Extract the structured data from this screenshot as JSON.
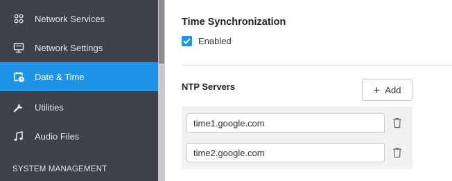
{
  "sidebar": {
    "items": [
      {
        "label": "Network Services",
        "icon": "network-services-icon"
      },
      {
        "label": "Network Settings",
        "icon": "monitor-icon"
      },
      {
        "label": "Date & Time",
        "icon": "calendar-clock-icon",
        "active": true
      },
      {
        "label": "Utilities",
        "icon": "wrench-icon"
      },
      {
        "label": "Audio Files",
        "icon": "music-note-icon"
      }
    ],
    "section_header": "SYSTEM MANAGEMENT"
  },
  "time_sync": {
    "title": "Time Synchronization",
    "enabled_label": "Enabled",
    "enabled": true
  },
  "ntp": {
    "label": "NTP Servers",
    "add_label": "Add",
    "servers": [
      "time1.google.com",
      "time2.google.com"
    ]
  },
  "colors": {
    "sidebar_bg": "#3d4149",
    "accent": "#1e94e8"
  }
}
